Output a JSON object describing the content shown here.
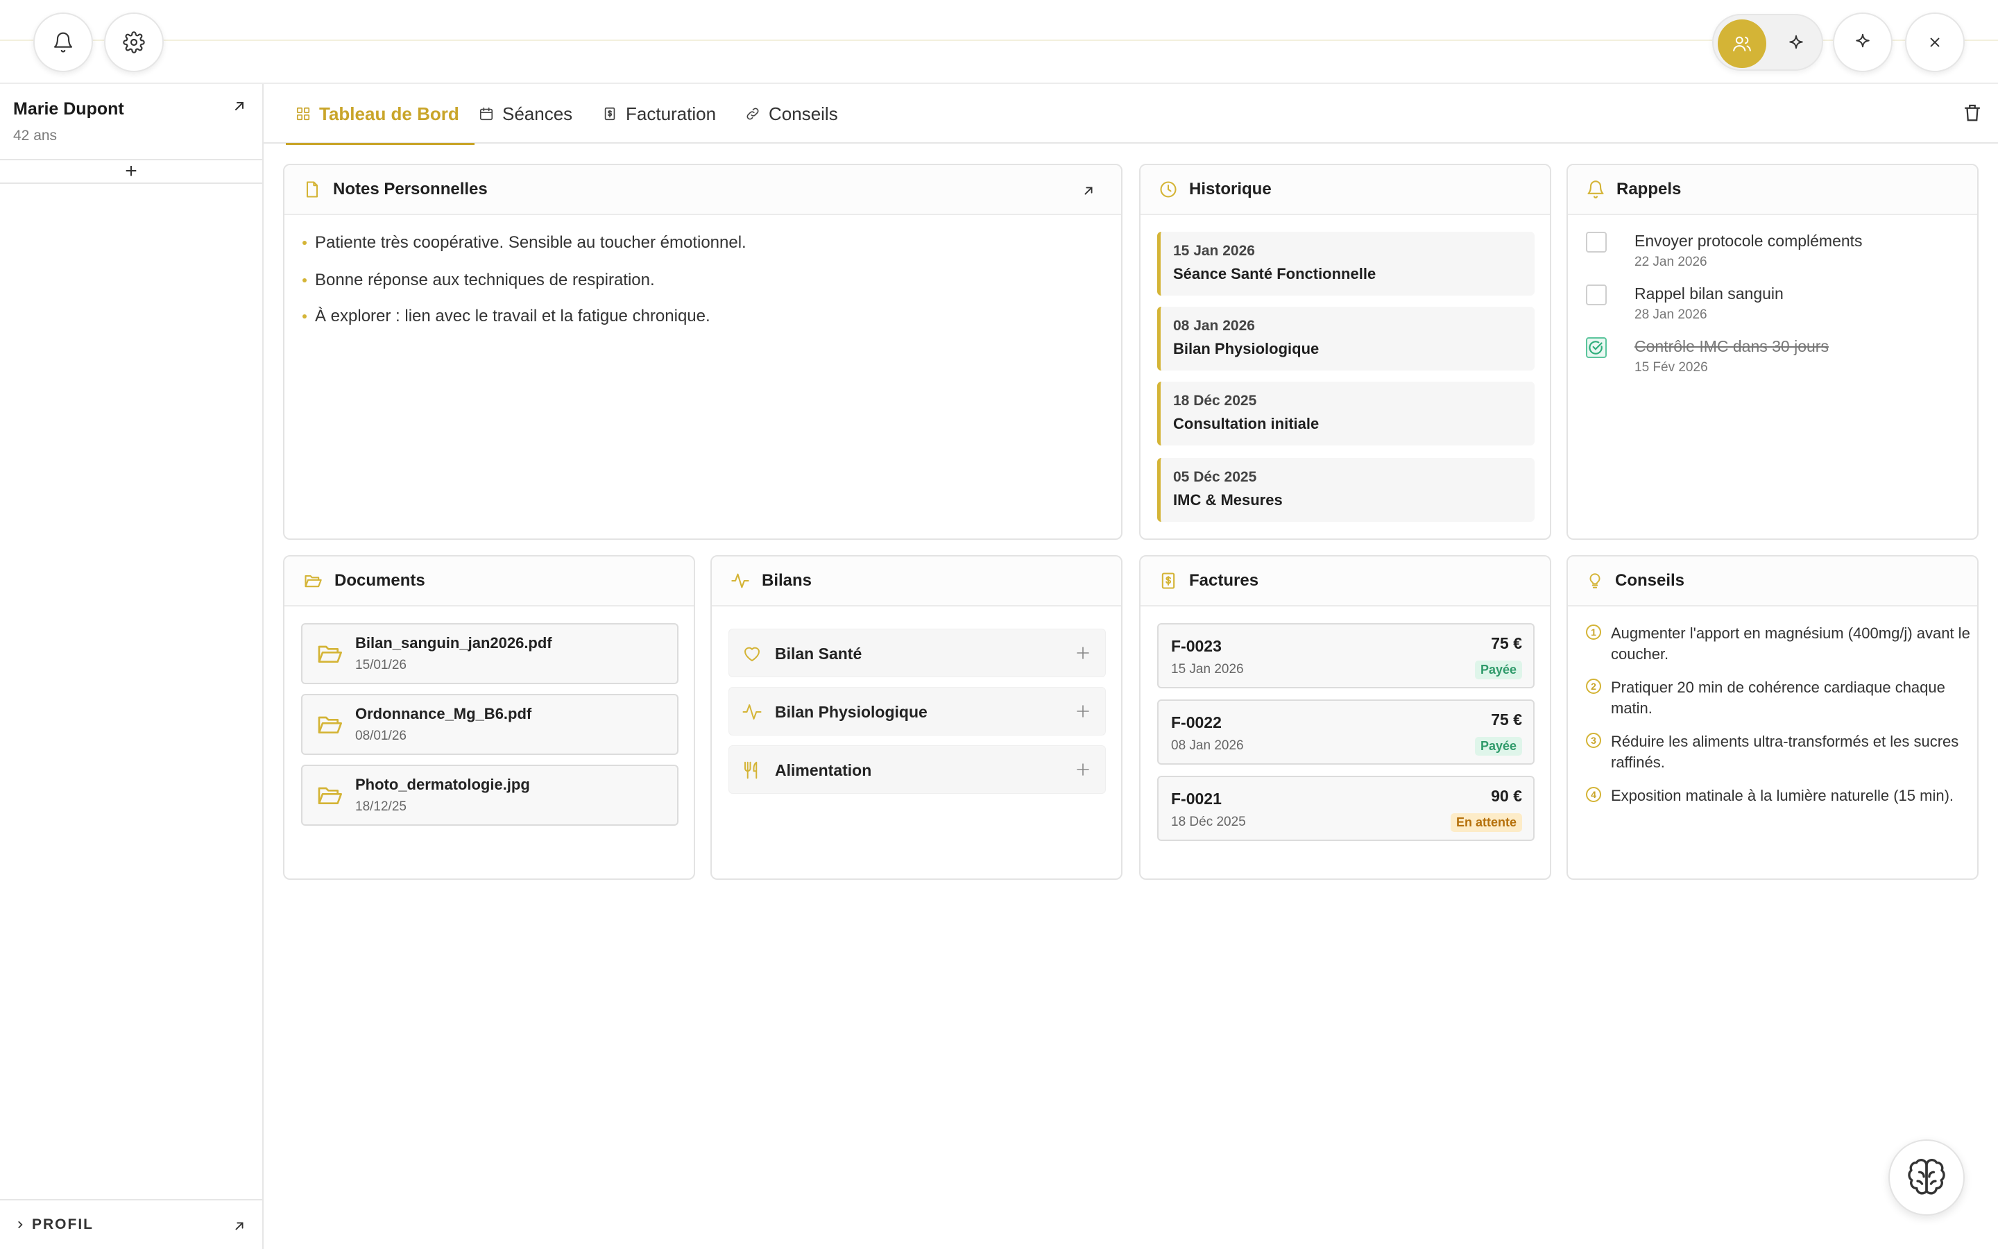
{
  "colors": {
    "accent": "#d4b436",
    "paid": "#2f9a6a",
    "pending": "#b5700b",
    "done": "#5cc59d"
  },
  "topbar": {
    "left_icons": [
      "bell-icon",
      "gear-icon"
    ],
    "right_icons": [
      "users-icon",
      "sparkle-icon",
      "sparkle-icon",
      "close-icon"
    ]
  },
  "patient": {
    "name": "Marie Dupont",
    "age": "42 ans"
  },
  "sidebar": {
    "add_symbol": "+",
    "profile_label": "PROFIL"
  },
  "tabs": [
    {
      "label": "Tableau de Bord",
      "icon": "grid-icon"
    },
    {
      "label": "Séances",
      "icon": "calendar-icon"
    },
    {
      "label": "Facturation",
      "icon": "invoice-icon"
    },
    {
      "label": "Conseils",
      "icon": "link-icon"
    }
  ],
  "notes": {
    "title": "Notes Personnelles",
    "items": [
      "Patiente très coopérative. Sensible au toucher émotionnel.",
      "Bonne réponse aux techniques de respiration.",
      "À explorer : lien avec le travail et la fatigue chronique."
    ]
  },
  "history": {
    "title": "Historique",
    "items": [
      {
        "date": "15 Jan 2026",
        "title": "Séance Santé Fonctionnelle"
      },
      {
        "date": "08 Jan 2026",
        "title": "Bilan Physiologique"
      },
      {
        "date": "18 Déc 2025",
        "title": "Consultation initiale"
      },
      {
        "date": "05 Déc 2025",
        "title": "IMC & Mesures"
      }
    ]
  },
  "reminders": {
    "title": "Rappels",
    "items": [
      {
        "text": "Envoyer protocole compléments",
        "date": "22 Jan 2026",
        "done": false
      },
      {
        "text": "Rappel bilan sanguin",
        "date": "28 Jan 2026",
        "done": false
      },
      {
        "text": "Contrôle IMC dans 30 jours",
        "date": "15 Fév 2026",
        "done": true
      }
    ]
  },
  "documents": {
    "title": "Documents",
    "items": [
      {
        "name": "Bilan_sanguin_jan2026.pdf",
        "date": "15/01/26"
      },
      {
        "name": "Ordonnance_Mg_B6.pdf",
        "date": "08/01/26"
      },
      {
        "name": "Photo_dermatologie.jpg",
        "date": "18/12/25"
      }
    ]
  },
  "bilans": {
    "title": "Bilans",
    "items": [
      {
        "label": "Bilan Santé",
        "icon": "heart-icon"
      },
      {
        "label": "Bilan Physiologique",
        "icon": "activity-icon"
      },
      {
        "label": "Alimentation",
        "icon": "utensils-icon"
      }
    ]
  },
  "invoices": {
    "title": "Factures",
    "items": [
      {
        "number": "F-0023",
        "date": "15 Jan 2026",
        "amount": "75 €",
        "status": "Payée",
        "status_kind": "paid"
      },
      {
        "number": "F-0022",
        "date": "08 Jan 2026",
        "amount": "75 €",
        "status": "Payée",
        "status_kind": "paid"
      },
      {
        "number": "F-0021",
        "date": "18 Déc 2025",
        "amount": "90 €",
        "status": "En attente",
        "status_kind": "pending"
      }
    ]
  },
  "tips": {
    "title": "Conseils",
    "items": [
      {
        "num": "1",
        "text": "Augmenter l'apport en magnésium (400mg/j) avant le coucher."
      },
      {
        "num": "2",
        "text": "Pratiquer 20 min de cohérence cardiaque chaque matin."
      },
      {
        "num": "3",
        "text": "Réduire les aliments ultra-transformés et les sucres raffinés."
      },
      {
        "num": "4",
        "text": "Exposition matinale à la lumière naturelle (15 min)."
      }
    ]
  }
}
